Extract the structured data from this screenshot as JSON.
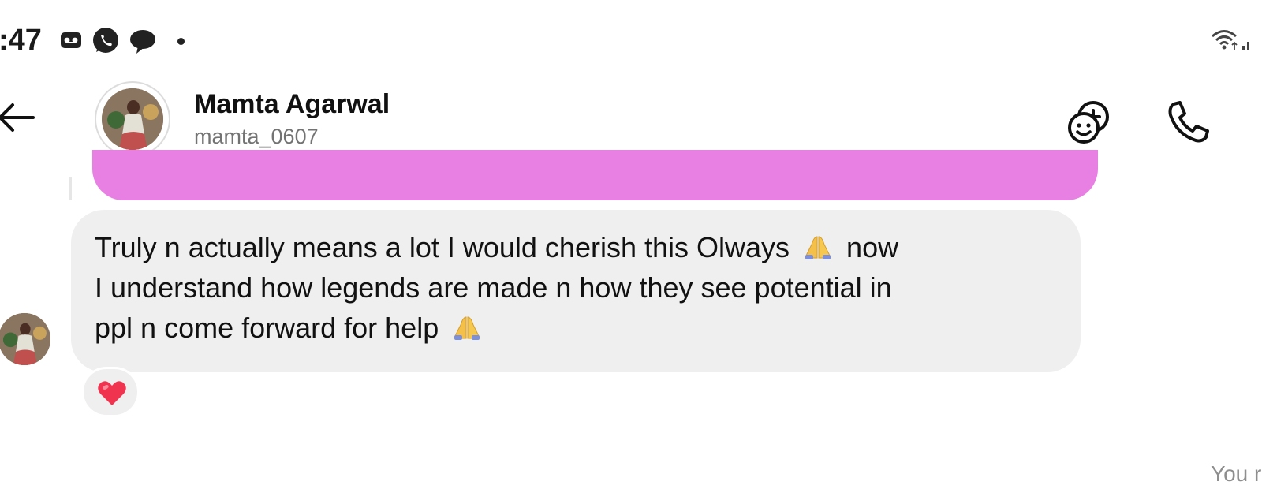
{
  "status_bar": {
    "time": ":47"
  },
  "header": {
    "contact_name": "Mamta Agarwal",
    "contact_handle": "mamta_0607",
    "icons": [
      "back-arrow-icon",
      "sticker-add-icon",
      "phone-icon"
    ]
  },
  "messages": [
    {
      "sender": "Mamta Agarwal",
      "lines": [
        {
          "text": "Truly n actually means a lot I would cherish this Olways",
          "emoji": "🙏",
          "after": "now"
        },
        {
          "text": "I understand how legends are made n how they see potential in"
        },
        {
          "text": "ppl n come forward for help",
          "emoji": "🙏"
        }
      ],
      "reaction": "❤️"
    }
  ],
  "footer": {
    "you_label": "You r"
  },
  "colors": {
    "pink_bubble": "#e87fe3",
    "received_bubble": "#efefef",
    "accent_text": "#737373"
  }
}
